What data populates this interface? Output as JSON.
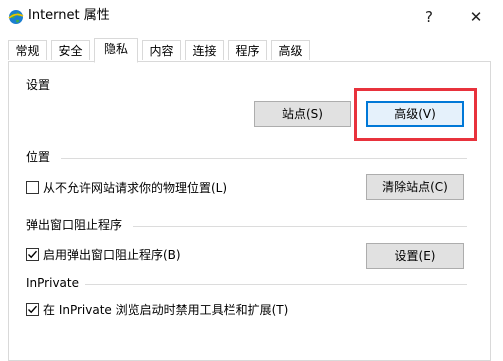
{
  "window": {
    "title": "Internet 属性",
    "help_glyph": "?",
    "close_glyph": "✕"
  },
  "tabs": [
    {
      "label": "常规"
    },
    {
      "label": "安全"
    },
    {
      "label": "隐私",
      "selected": true
    },
    {
      "label": "内容"
    },
    {
      "label": "连接"
    },
    {
      "label": "程序"
    },
    {
      "label": "高级"
    }
  ],
  "settings_group": {
    "label": "设置",
    "sites_button": "站点(S)",
    "advanced_button": "高级(V)"
  },
  "location_group": {
    "label": "位置",
    "checkbox_label": "从不允许网站请求你的物理位置(L)",
    "checkbox_checked": false,
    "clear_button": "清除站点(C)"
  },
  "popup_group": {
    "label": "弹出窗口阻止程序",
    "checkbox_label": "启用弹出窗口阻止程序(B)",
    "checkbox_checked": true,
    "settings_button": "设置(E)"
  },
  "inprivate_group": {
    "label": "InPrivate",
    "checkbox_label": "在 InPrivate 浏览启动时禁用工具栏和扩展(T)",
    "checkbox_checked": true
  },
  "colors": {
    "highlight": "#e8323c",
    "default_button_border": "#0078d7",
    "default_button_fill": "#e5f1fb",
    "button_fill": "#e1e1e1"
  },
  "icons": {
    "app": "globe-icon",
    "help": "help-icon",
    "close": "close-icon",
    "check": "checkmark-icon"
  }
}
